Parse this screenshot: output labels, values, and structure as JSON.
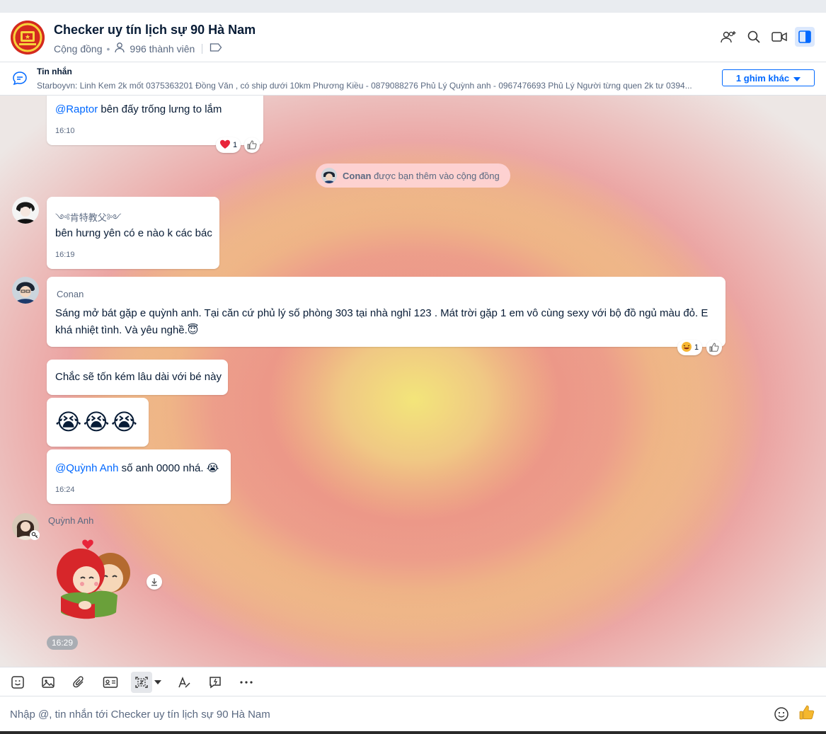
{
  "header": {
    "title": "Checker uy tín lịch sự 90 Hà Nam",
    "type_label": "Cộng đồng",
    "members": "996 thành viên"
  },
  "pinned": {
    "label": "Tin nhắn",
    "text": "Starboyvn: Linh Kem 2k mốt 0375363201 Đồng Văn , có ship dưới 10km Phương Kiều - 0879088276 Phủ Lý Quỳnh anh - 0967476693 Phủ Lý Người từng quen 2k tư 0394...",
    "more_button": "1 ghim khác"
  },
  "messages": {
    "m1": {
      "mention": "@Raptor",
      "text": " bên đấy trống lưng to lắm",
      "time": "16:10",
      "heart_count": "1"
    },
    "system": {
      "name": "Conan",
      "text": " được bạn thêm vào cộng đồng"
    },
    "m2": {
      "sender": "༺肯特教父༻",
      "text": "bên hưng yên có e nào k các bác",
      "time": "16:19"
    },
    "m3": {
      "sender": "Conan",
      "text": "Sáng mở bát gặp e quỳnh anh. Tại căn cứ phủ lý số phòng 303 tại nhà nghỉ 123 . Mát trời gặp 1 em vô cùng sexy với bộ đồ ngủ màu đỏ. E khá nhiệt tình. Và yêu nghề.😇",
      "react_count": "1"
    },
    "m4": {
      "text": "Chắc sẽ tốn kém lâu dài với bé này"
    },
    "m5": {
      "text": "😭😭😭"
    },
    "m6": {
      "mention": "@Quỳnh Anh",
      "text": "  số anh 0000 nhá. 😭",
      "time": "16:24"
    },
    "m7": {
      "sender": "Quỳnh Anh",
      "time": "16:29"
    }
  },
  "composer": {
    "placeholder": "Nhập @, tin nhắn tới Checker uy tín lịch sự 90 Hà Nam"
  },
  "colors": {
    "accent": "#0068ff",
    "text": "#081c36",
    "muted": "#5a6981"
  }
}
